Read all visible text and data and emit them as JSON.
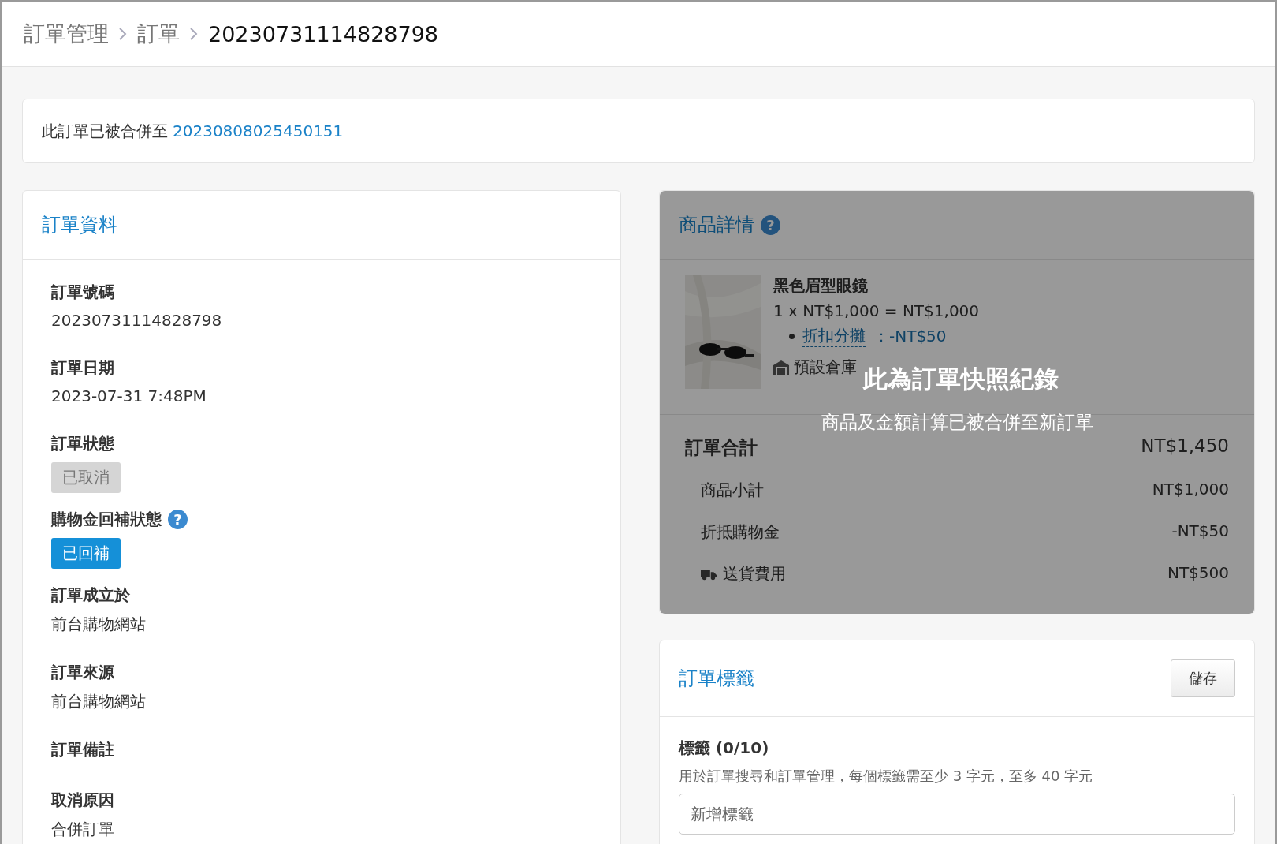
{
  "breadcrumb": [
    {
      "label": "訂單管理",
      "current": false
    },
    {
      "label": "訂單",
      "current": false
    },
    {
      "label": "20230731114828798",
      "current": true
    }
  ],
  "merge_notice": {
    "text": "此訂單已被合併至",
    "link": "20230808025450151"
  },
  "order_info": {
    "title": "訂單資料",
    "fields": [
      {
        "label": "訂單號碼",
        "kind": "text",
        "value": "20230731114828798"
      },
      {
        "label": "訂單日期",
        "kind": "text",
        "value": "2023-07-31 7:48PM"
      },
      {
        "label": "訂單狀態",
        "kind": "badge",
        "value": "已取消",
        "active": false
      },
      {
        "label": "購物金回補狀態",
        "kind": "badge",
        "value": "已回補",
        "active": true,
        "help": "?"
      },
      {
        "label": "訂單成立於",
        "kind": "text",
        "value": "前台購物網站"
      },
      {
        "label": "訂單來源",
        "kind": "text",
        "value": "前台購物網站"
      },
      {
        "label": "訂單備註",
        "kind": "empty"
      },
      {
        "label": "取消原因",
        "kind": "text",
        "value": "合併訂單"
      }
    ]
  },
  "product_details": {
    "title": "商品詳情",
    "help": "?",
    "item": {
      "kind": "picture",
      "name": "黑色眉型眼鏡",
      "price_line": "1 x NT$1,000 = NT$1,000",
      "discount_label": "折扣分攤",
      "discount_value": "：-NT$50",
      "warehouse": "預設倉庫"
    },
    "total": {
      "label": "訂單合計",
      "value": "NT$1,450"
    },
    "lines": [
      {
        "label": "商品小計",
        "value": "NT$1,000",
        "kind": "plain"
      },
      {
        "label": "折抵購物金",
        "value": "-NT$50",
        "kind": "plain"
      },
      {
        "label": "送貨費用",
        "value": "NT$500",
        "kind": "shipping"
      }
    ],
    "overlay": {
      "title": "此為訂單快照紀錄",
      "subtitle": "商品及金額計算已被合併至新訂單"
    }
  },
  "order_tags": {
    "title": "訂單標籤",
    "save_button": "儲存",
    "field_label": "標籤 (0/10)",
    "hint": "用於訂單搜尋和訂單管理，每個標籤需至少 3 字元，至多 40 字元",
    "placeholder": "新增標籤"
  }
}
